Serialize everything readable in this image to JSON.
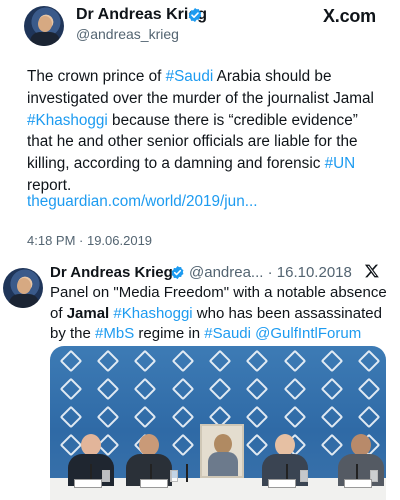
{
  "tweet": {
    "author_name": "Dr Andreas Krieg",
    "handle": "@andreas_krieg",
    "platform_logo": "X.com",
    "text_segments": [
      {
        "t": "The crown prince of ",
        "tag": false
      },
      {
        "t": "#Saudi",
        "tag": true
      },
      {
        "t": " Arabia should be investigated over the murder of the journalist Jamal ",
        "tag": false
      },
      {
        "t": "#Khashoggi",
        "tag": true
      },
      {
        "t": " because there is “credible evidence” that he and other senior officials are liable for the killing, according to a damning and forensic ",
        "tag": false
      },
      {
        "t": "#UN",
        "tag": true
      },
      {
        "t": " report.",
        "tag": false
      }
    ],
    "link_text": "theguardian.com/world/2019/jun...",
    "timestamp": "4:18 PM · 19.06.2019"
  },
  "quoted_tweet": {
    "author_name": "Dr Andreas Krieg",
    "handle_date": "@andrea... · 16.10.2018",
    "close_icon": "x-logo-icon",
    "text_segments": [
      {
        "t": "Panel on \"Media Freedom\" with a notable absence of ",
        "style": "plain"
      },
      {
        "t": "Jamal",
        "style": "bold"
      },
      {
        "t": " ",
        "style": "plain"
      },
      {
        "t": "#Khashoggi",
        "style": "tag"
      },
      {
        "t": " who has been assassinated by the ",
        "style": "plain"
      },
      {
        "t": "#MbS",
        "style": "tag"
      },
      {
        "t": " regime in ",
        "style": "plain"
      },
      {
        "t": "#Saudi",
        "style": "tag"
      },
      {
        "t": " ",
        "style": "plain"
      },
      {
        "t": "@GulfIntlForum",
        "style": "tag"
      }
    ],
    "photo_description": "panel-photo"
  },
  "colors": {
    "link": "#1d9bf0",
    "text": "#0f1419",
    "muted": "#536471",
    "verified": "#1d9bf0",
    "backdrop": "#3d7bb5"
  }
}
